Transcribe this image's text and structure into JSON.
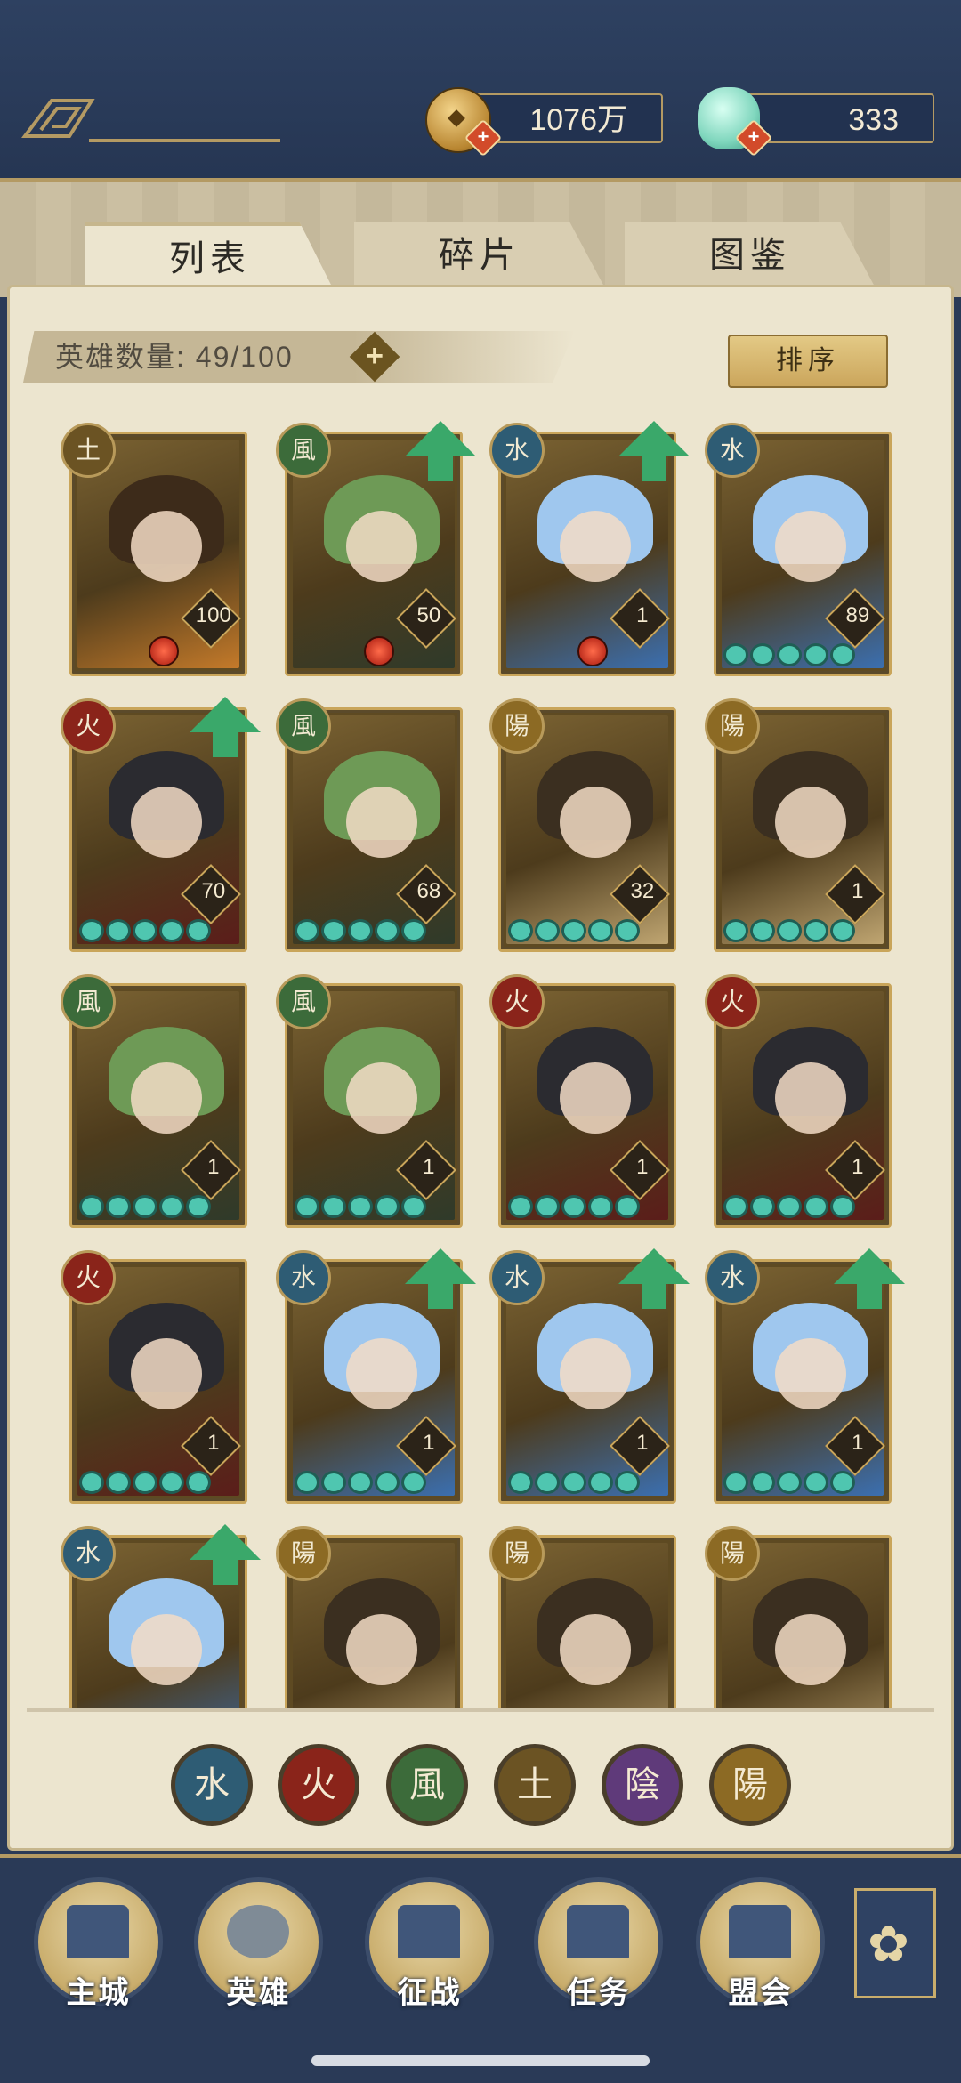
{
  "currency": {
    "coins": "1076万",
    "jade": "333",
    "coin_icon": "copper-coin-icon",
    "jade_icon": "jade-shell-icon",
    "add_glyph": "+"
  },
  "tabs": {
    "list": "列表",
    "fragments": "碎片",
    "atlas": "图鉴"
  },
  "hero_count": {
    "label": "英雄数量:",
    "value": "49/100",
    "add_glyph": "+"
  },
  "sort_label": "排序",
  "element_glyphs": {
    "water": "水",
    "fire": "火",
    "wind": "風",
    "earth": "土",
    "yin": "陰",
    "yang": "陽"
  },
  "colors": {
    "water": "#2e5c74",
    "fire": "#8a241a",
    "wind": "#3c6b3a",
    "earth": "#6b5323",
    "yin": "#5f3a7a",
    "yang": "#8c6a24",
    "upgrade_arrow": "#3aa86a",
    "frame_gold": "#c9a55a"
  },
  "heroes": [
    {
      "element": "土",
      "level": "100",
      "stars": 0,
      "red_gem": true,
      "upgrade": false
    },
    {
      "element": "風",
      "level": "50",
      "stars": 0,
      "red_gem": true,
      "upgrade": true
    },
    {
      "element": "水",
      "level": "1",
      "stars": 0,
      "red_gem": true,
      "upgrade": true
    },
    {
      "element": "水",
      "level": "89",
      "stars": 5,
      "red_gem": false,
      "upgrade": false
    },
    {
      "element": "火",
      "level": "70",
      "stars": 5,
      "red_gem": false,
      "upgrade": true
    },
    {
      "element": "風",
      "level": "68",
      "stars": 5,
      "red_gem": false,
      "upgrade": false
    },
    {
      "element": "陽",
      "level": "32",
      "stars": 5,
      "red_gem": false,
      "upgrade": false
    },
    {
      "element": "陽",
      "level": "1",
      "stars": 5,
      "red_gem": false,
      "upgrade": false
    },
    {
      "element": "風",
      "level": "1",
      "stars": 5,
      "red_gem": false,
      "upgrade": false
    },
    {
      "element": "風",
      "level": "1",
      "stars": 5,
      "red_gem": false,
      "upgrade": false
    },
    {
      "element": "火",
      "level": "1",
      "stars": 5,
      "red_gem": false,
      "upgrade": false
    },
    {
      "element": "火",
      "level": "1",
      "stars": 5,
      "red_gem": false,
      "upgrade": false
    },
    {
      "element": "火",
      "level": "1",
      "stars": 5,
      "red_gem": false,
      "upgrade": false
    },
    {
      "element": "水",
      "level": "1",
      "stars": 5,
      "red_gem": false,
      "upgrade": true
    },
    {
      "element": "水",
      "level": "1",
      "stars": 5,
      "red_gem": false,
      "upgrade": true
    },
    {
      "element": "水",
      "level": "1",
      "stars": 5,
      "red_gem": false,
      "upgrade": true
    },
    {
      "element": "水",
      "level": "",
      "stars": 0,
      "red_gem": false,
      "upgrade": true
    },
    {
      "element": "陽",
      "level": "",
      "stars": 0,
      "red_gem": false,
      "upgrade": false
    },
    {
      "element": "陽",
      "level": "",
      "stars": 0,
      "red_gem": false,
      "upgrade": false
    },
    {
      "element": "陽",
      "level": "",
      "stars": 0,
      "red_gem": false,
      "upgrade": false
    }
  ],
  "nav": {
    "main_city": "主城",
    "heroes": "英雄",
    "campaign": "征战",
    "quests": "任务",
    "guild": "盟会",
    "more_glyph": "✿"
  }
}
